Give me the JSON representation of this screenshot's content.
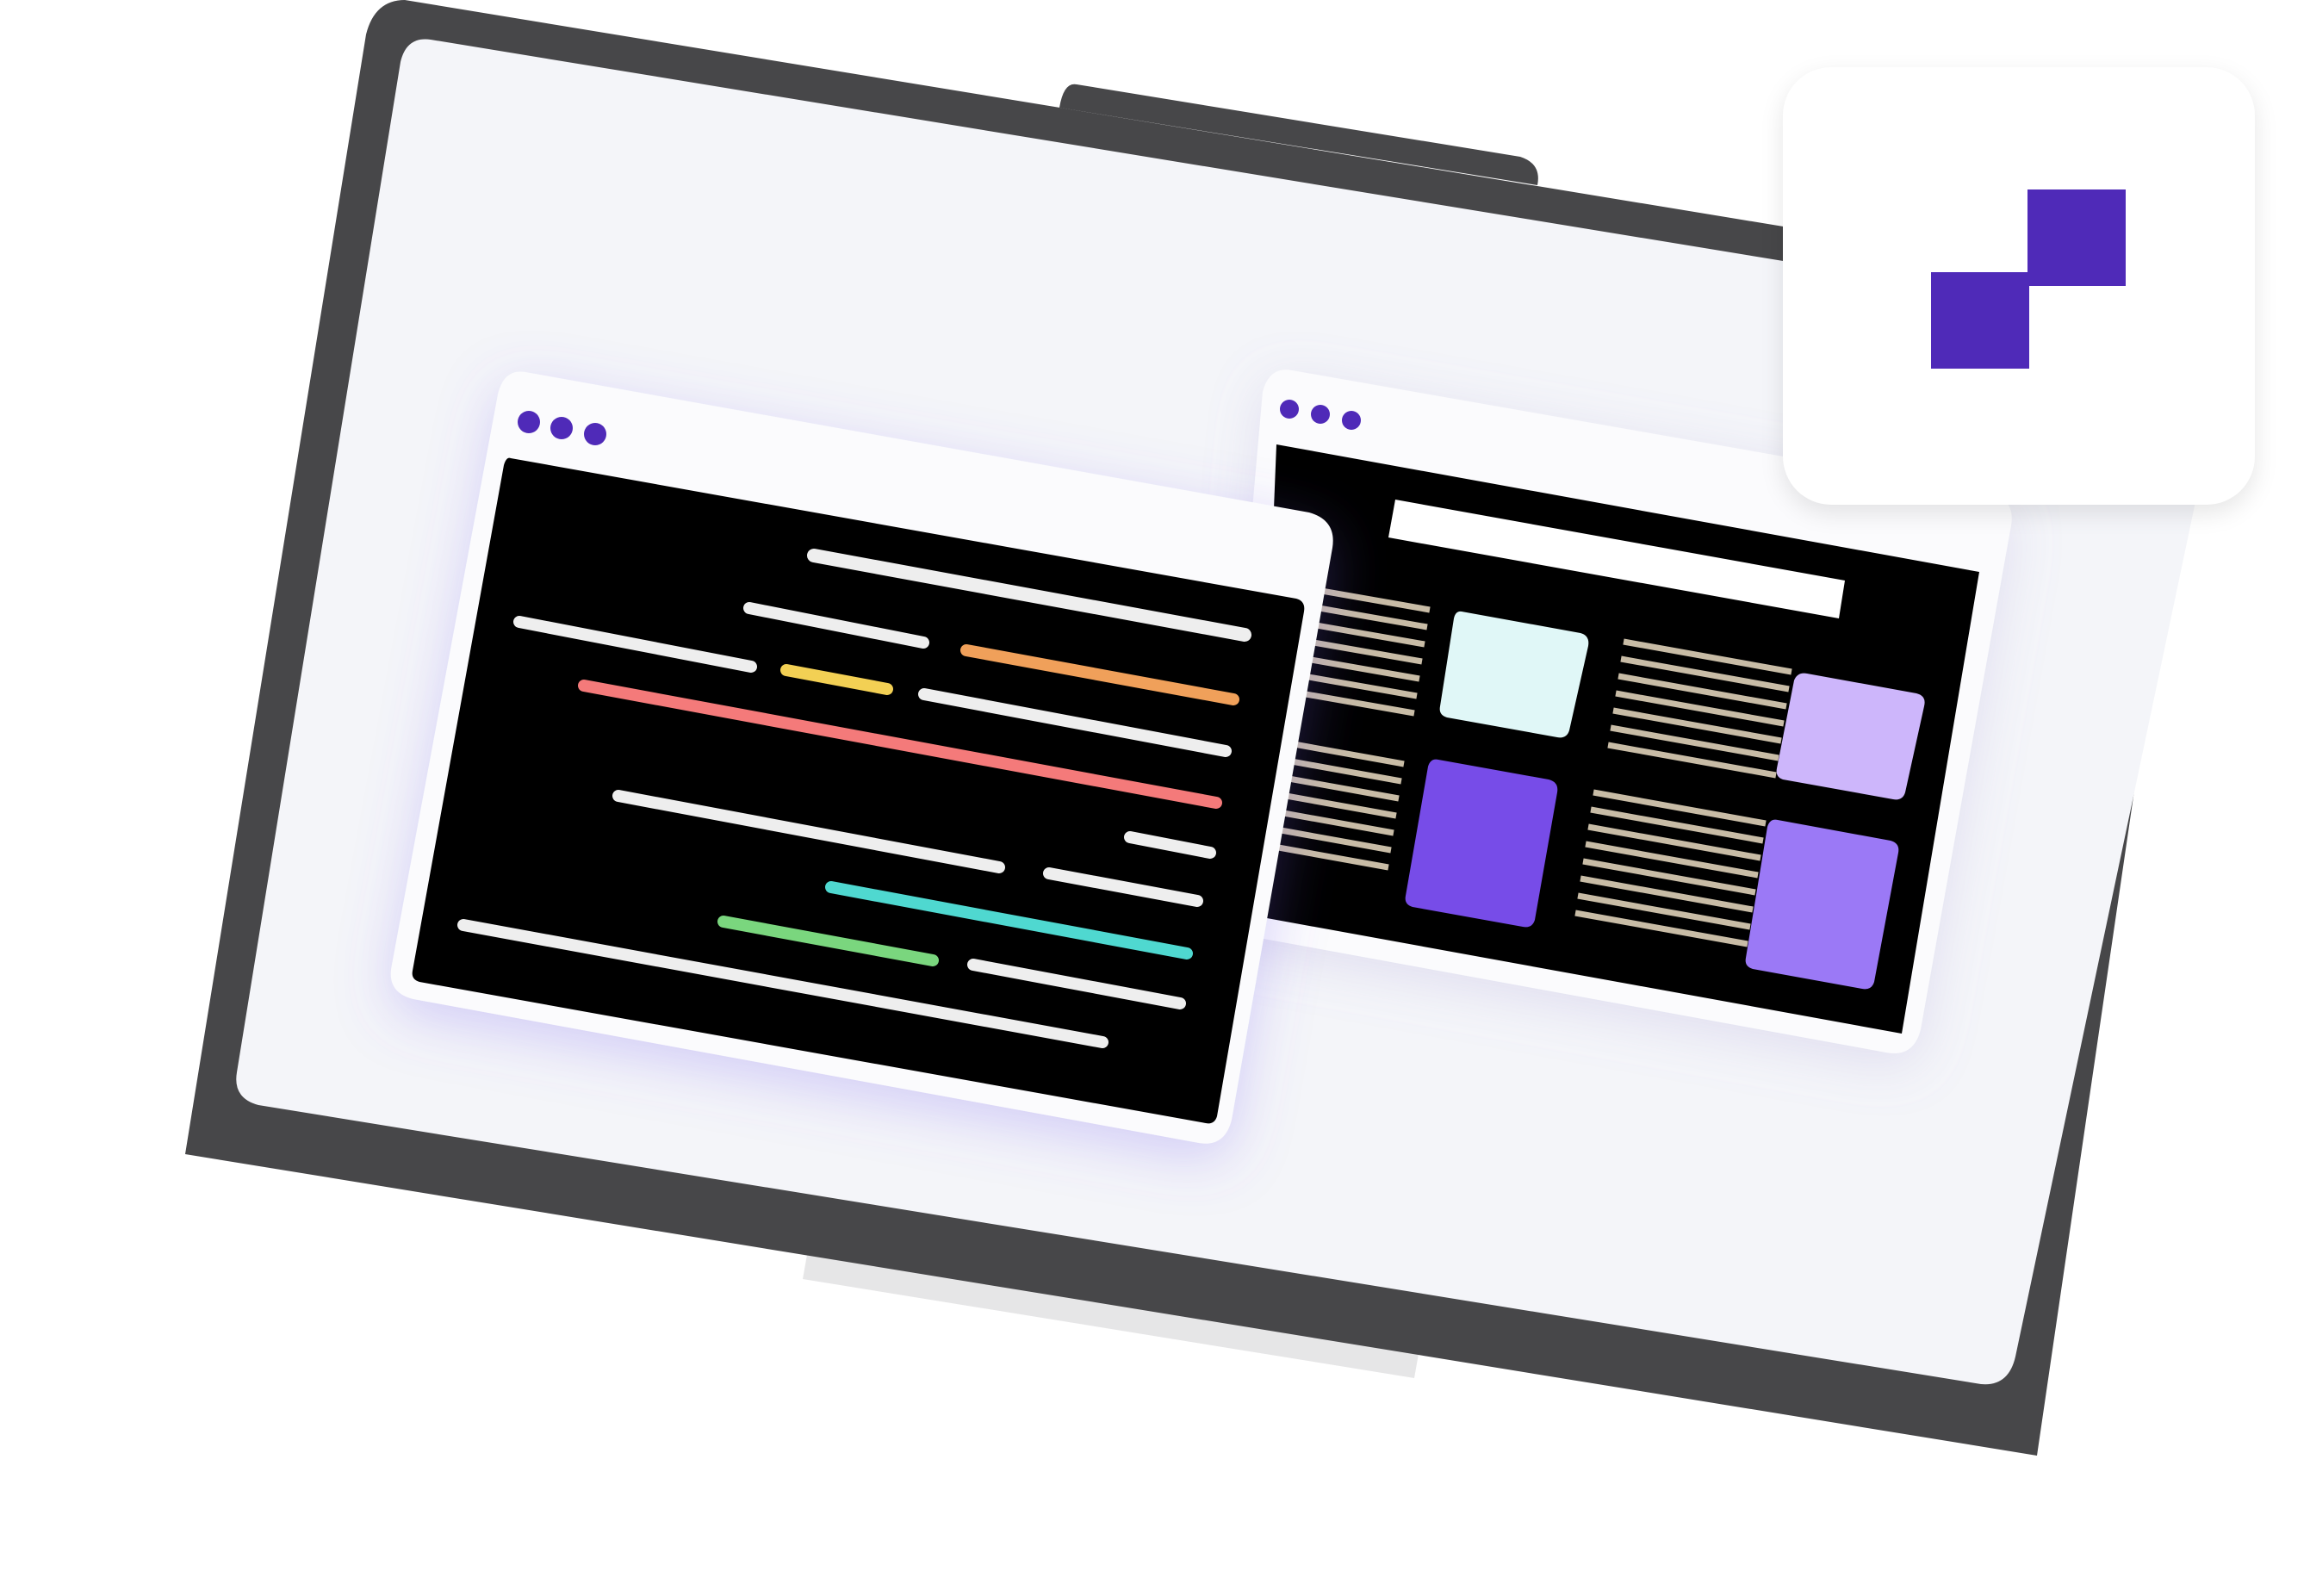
{
  "colors": {
    "monitor_frame": "#474749",
    "monitor_stand": "#e6e6e7",
    "screen": "#f4f5f9",
    "window_chrome": "#fbfbfd",
    "window_dot": "#4f2ab8",
    "code_bg": "#000000",
    "code_line_default": "#eeeeee",
    "code_line_orange": "#f0a05a",
    "code_line_yellow": "#f3d054",
    "code_line_red": "#f47a7a",
    "code_line_cyan": "#4fd8d0",
    "code_line_green": "#7ad67e",
    "text_line_tan": "#c8bca6",
    "card_mint": "#e0f7f7",
    "card_lavender": "#cdb6fb",
    "card_violet": "#774ce8",
    "card_purple": "#9b79f6",
    "logo_purple": "#4f2ab8"
  },
  "icons": {
    "logo": "stacked-squares-logo-icon",
    "window_controls": "window-dots-icon"
  },
  "code_window": {
    "line_colors": [
      "code_line_default",
      "code_line_default",
      "code_line_default",
      "code_line_orange",
      "code_line_yellow",
      "code_line_red",
      "code_line_default",
      "code_line_default",
      "code_line_default",
      "code_line_default",
      "code_line_cyan",
      "code_line_green",
      "code_line_default",
      "code_line_default"
    ]
  },
  "preview_window": {
    "cards": [
      "card_mint",
      "card_lavender",
      "card_violet",
      "card_purple"
    ]
  }
}
